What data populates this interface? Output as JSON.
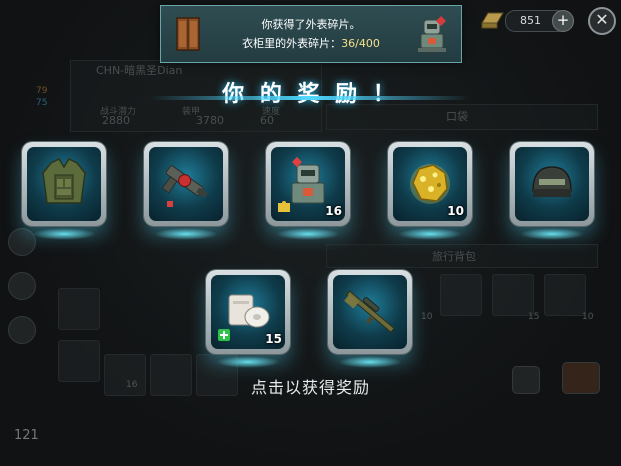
{
  "banner": {
    "line1": "你获得了外表碎片。",
    "line2_prefix": "衣柜里的外表碎片：",
    "line2_value": "36/400"
  },
  "currency": {
    "amount": "851"
  },
  "title": "你 的 奖 励 ！",
  "rewards": [
    {
      "name": "armor-vest",
      "qty": ""
    },
    {
      "name": "red-blaster",
      "qty": ""
    },
    {
      "name": "robot-skin-fragment",
      "qty": "16"
    },
    {
      "name": "gold-ore",
      "qty": "10"
    },
    {
      "name": "combat-helmet",
      "qty": ""
    },
    {
      "name": "bandage-medkit",
      "qty": "15"
    },
    {
      "name": "sniper-rifle",
      "qty": ""
    }
  ],
  "hint": "点击以获得奖励",
  "background": {
    "player_name": "CHN-暗黑圣Dian",
    "stat1": "2880",
    "stat2": "3780",
    "stat3": "60",
    "stat1_label": "战斗潜力",
    "stat2_label": "装甲",
    "stat3_label": "速度",
    "pocket_label": "口袋",
    "backpack_label": "旅行背包",
    "hp": "79",
    "water": "75",
    "level": "121",
    "slot_counts": [
      "10",
      "15",
      "10",
      "16"
    ]
  },
  "colors": {
    "accent": "#4fd8ff",
    "card_inner": "#1f7c98",
    "highlight": "#f5e08a"
  }
}
